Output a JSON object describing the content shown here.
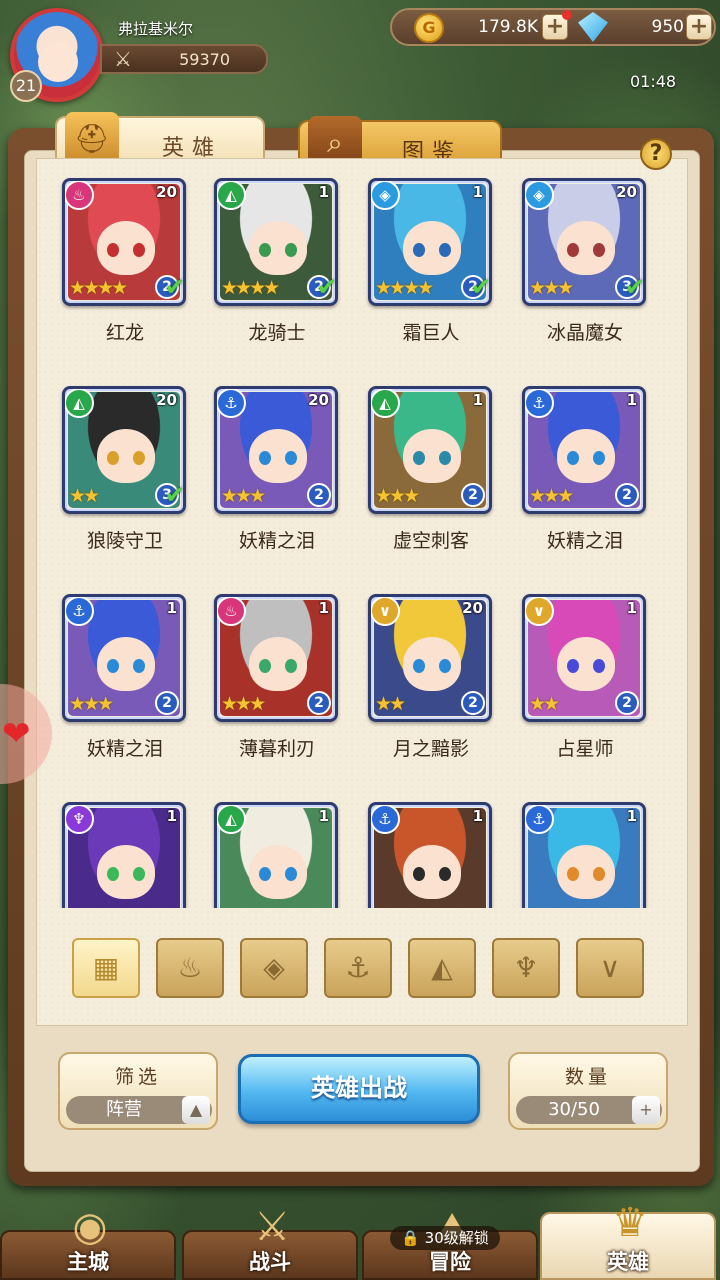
{
  "player": {
    "name": "弗拉基米尔",
    "level": "21",
    "power": "59370"
  },
  "resources": {
    "gold": "179.8K",
    "gems": "950",
    "plus": "+"
  },
  "clock": "01:48",
  "tabs": [
    {
      "label": "英雄",
      "icon": "helmet-icon"
    },
    {
      "label": "图鉴",
      "icon": "magnifier-icon"
    }
  ],
  "help": "?",
  "heroes": [
    {
      "name": "红龙",
      "level": "20",
      "faction": "fire",
      "faction_color": "#d8357a",
      "stars": "★★★★",
      "qty": "2",
      "check": true,
      "hair": "#e04a52",
      "bg": "#b93a3a",
      "eyes": "#c42f2f"
    },
    {
      "name": "龙骑士",
      "level": "1",
      "faction": "beast",
      "faction_color": "#28a84a",
      "stars": "★★★★",
      "qty": "2",
      "check": true,
      "hair": "#e6e6e6",
      "bg": "#3d5a3a",
      "eyes": "#3a9a52"
    },
    {
      "name": "霜巨人",
      "level": "1",
      "faction": "water",
      "faction_color": "#2a9be0",
      "stars": "★★★★",
      "qty": "2",
      "check": true,
      "hair": "#4ab8e6",
      "bg": "#2f7fbf",
      "eyes": "#2a6ab8"
    },
    {
      "name": "冰晶魔女",
      "level": "20",
      "faction": "water",
      "faction_color": "#2a9be0",
      "stars": "★★★",
      "qty": "3",
      "check": true,
      "hair": "#c9cde8",
      "bg": "#5d6ab8",
      "eyes": "#a03a3a"
    },
    {
      "name": "狼陵守卫",
      "level": "20",
      "faction": "beast",
      "faction_color": "#28a84a",
      "stars": "★★",
      "qty": "3",
      "check": true,
      "hair": "#2a2a2a",
      "bg": "#3a8a7a",
      "eyes": "#d8a02a"
    },
    {
      "name": "妖精之泪",
      "level": "20",
      "faction": "anchor",
      "faction_color": "#2a6ad8",
      "stars": "★★★",
      "qty": "2",
      "check": false,
      "hair": "#3a5ad8",
      "bg": "#7a5ab8",
      "eyes": "#2a8ad8"
    },
    {
      "name": "虚空刺客",
      "level": "1",
      "faction": "beast",
      "faction_color": "#28a84a",
      "stars": "★★★",
      "qty": "2",
      "check": false,
      "hair": "#3ab88a",
      "bg": "#8a6a3a",
      "eyes": "#2a8aa8"
    },
    {
      "name": "妖精之泪",
      "level": "1",
      "faction": "anchor",
      "faction_color": "#2a6ad8",
      "stars": "★★★",
      "qty": "2",
      "check": false,
      "hair": "#3a5ad8",
      "bg": "#7a5ab8",
      "eyes": "#2a8ad8"
    },
    {
      "name": "妖精之泪",
      "level": "1",
      "faction": "anchor",
      "faction_color": "#2a6ad8",
      "stars": "★★★",
      "qty": "2",
      "check": false,
      "hair": "#3a5ad8",
      "bg": "#7a5ab8",
      "eyes": "#2a8ad8"
    },
    {
      "name": "薄暮利刃",
      "level": "1",
      "faction": "fire",
      "faction_color": "#d8357a",
      "stars": "★★★",
      "qty": "2",
      "check": false,
      "hair": "#bfbfbf",
      "bg": "#a8322a",
      "eyes": "#3aa86a"
    },
    {
      "name": "月之黯影",
      "level": "20",
      "faction": "light",
      "faction_color": "#e0a82a",
      "stars": "★★",
      "qty": "2",
      "check": false,
      "hair": "#f0c83a",
      "bg": "#3a4a8a",
      "eyes": "#2a8ad8"
    },
    {
      "name": "占星师",
      "level": "1",
      "faction": "light",
      "faction_color": "#e0a82a",
      "stars": "★★",
      "qty": "2",
      "check": false,
      "hair": "#d84ab8",
      "bg": "#b85ab8",
      "eyes": "#4a4ad8"
    },
    {
      "name": "",
      "level": "1",
      "faction": "dark",
      "faction_color": "#8a3ad8",
      "stars": "",
      "qty": "",
      "check": false,
      "hair": "#6a3ab8",
      "bg": "#4a2a8a",
      "eyes": "#3ab85a"
    },
    {
      "name": "",
      "level": "1",
      "faction": "beast",
      "faction_color": "#28a84a",
      "stars": "",
      "qty": "",
      "check": false,
      "hair": "#f0ece0",
      "bg": "#4a8a5a",
      "eyes": "#2a8ad8"
    },
    {
      "name": "",
      "level": "1",
      "faction": "anchor",
      "faction_color": "#2a6ad8",
      "stars": "",
      "qty": "",
      "check": false,
      "hair": "#c8562a",
      "bg": "#5a3a2a",
      "eyes": "#2a2a2a"
    },
    {
      "name": "",
      "level": "1",
      "faction": "anchor",
      "faction_color": "#2a6ad8",
      "stars": "",
      "qty": "",
      "check": false,
      "hair": "#3ab8e6",
      "bg": "#3a7abf",
      "eyes": "#e08a2a"
    }
  ],
  "faction_filters": [
    {
      "id": "all",
      "icon": "grid-icon",
      "glyph": "▦"
    },
    {
      "id": "fire",
      "icon": "fire-faction-icon",
      "glyph": "♨"
    },
    {
      "id": "water",
      "icon": "water-faction-icon",
      "glyph": "◈"
    },
    {
      "id": "anchor",
      "icon": "anchor-faction-icon",
      "glyph": "⚓"
    },
    {
      "id": "beast",
      "icon": "beast-faction-icon",
      "glyph": "◭"
    },
    {
      "id": "dark",
      "icon": "dark-faction-icon",
      "glyph": "♆"
    },
    {
      "id": "light",
      "icon": "light-faction-icon",
      "glyph": "∨"
    }
  ],
  "filter": {
    "title": "筛选",
    "value": "阵营",
    "arrow": "▲"
  },
  "deploy": {
    "label": "英雄出战"
  },
  "count": {
    "title": "数量",
    "value": "30/50",
    "plus": "+"
  },
  "nav": [
    {
      "label": "主城",
      "icon": "castle-icon",
      "glyph": "◉",
      "active": false
    },
    {
      "label": "战斗",
      "icon": "crossed-swords-icon",
      "glyph": "⚔",
      "active": false
    },
    {
      "label": "冒险",
      "icon": "map-icon",
      "glyph": "⛰",
      "active": false
    },
    {
      "label": "英雄",
      "icon": "hero-crest-icon",
      "glyph": "♛",
      "active": true
    }
  ],
  "lock": {
    "text": "30级解锁"
  },
  "colors": {
    "accent": "#53b8f0",
    "panel": "#f5eddc",
    "wood": "#6b4a2e"
  }
}
